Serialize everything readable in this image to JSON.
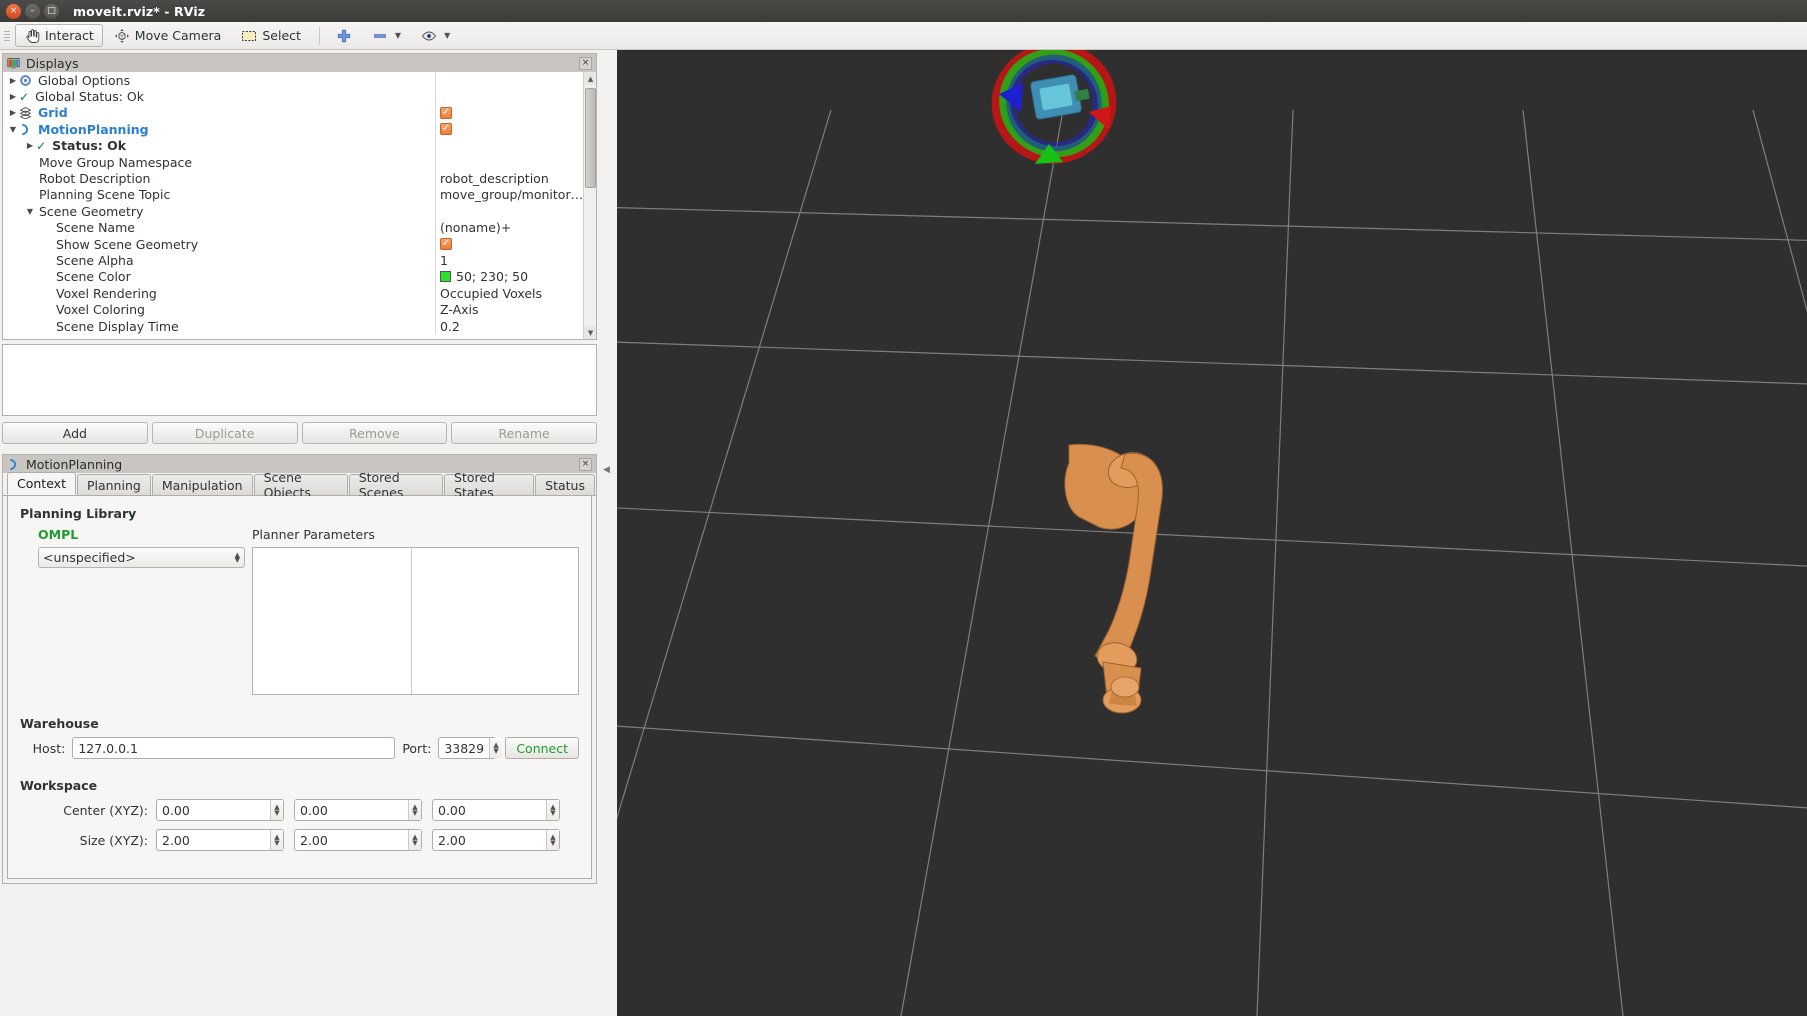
{
  "window": {
    "title": "moveit.rviz* - RViz",
    "close_glyph": "×",
    "min_glyph": "–",
    "max_glyph": "□"
  },
  "toolbar": {
    "items": [
      {
        "label": "Interact",
        "icon": "hand-cursor-icon",
        "active": true
      },
      {
        "label": "Move Camera",
        "icon": "move-camera-icon",
        "active": false
      },
      {
        "label": "Select",
        "icon": "select-rectangle-icon",
        "active": false
      }
    ],
    "add_tool_label": "+",
    "remove_tool_label": "−",
    "remove_dropdown_glyph": "▼",
    "view_icon_label": "eye-icon",
    "view_dropdown_glyph": "▼"
  },
  "displays": {
    "title": "Displays",
    "close_glyph": "×",
    "rows": [
      {
        "indent": 0,
        "arrow": "▶",
        "icon": "gear-icon",
        "label": "Global Options",
        "style": "plain",
        "value": "",
        "value_type": "none"
      },
      {
        "indent": 0,
        "arrow": "▶",
        "icon": "check-icon",
        "label": "Global Status: Ok",
        "style": "plain",
        "value": "",
        "value_type": "none"
      },
      {
        "indent": 0,
        "arrow": "▶",
        "icon": "grid-icon",
        "label": "Grid",
        "style": "link",
        "value": "",
        "value_type": "checkbox"
      },
      {
        "indent": 0,
        "arrow": "▼",
        "icon": "motion-icon",
        "label": "MotionPlanning",
        "style": "link",
        "value": "",
        "value_type": "checkbox"
      },
      {
        "indent": 1,
        "arrow": "▶",
        "icon": "check-icon",
        "label": "Status: Ok",
        "style": "bold",
        "value": "",
        "value_type": "none"
      },
      {
        "indent": 1,
        "arrow": "",
        "icon": "",
        "label": "Move Group Namespace",
        "style": "plain",
        "value": "",
        "value_type": "text"
      },
      {
        "indent": 1,
        "arrow": "",
        "icon": "",
        "label": "Robot Description",
        "style": "plain",
        "value": "robot_description",
        "value_type": "text"
      },
      {
        "indent": 1,
        "arrow": "",
        "icon": "",
        "label": "Planning Scene Topic",
        "style": "plain",
        "value": "move_group/monitor…",
        "value_type": "text"
      },
      {
        "indent": 1,
        "arrow": "▼",
        "icon": "",
        "label": "Scene Geometry",
        "style": "plain",
        "value": "",
        "value_type": "none"
      },
      {
        "indent": 2,
        "arrow": "",
        "icon": "",
        "label": "Scene Name",
        "style": "plain",
        "value": "(noname)+",
        "value_type": "text"
      },
      {
        "indent": 2,
        "arrow": "",
        "icon": "",
        "label": "Show Scene Geometry",
        "style": "plain",
        "value": "",
        "value_type": "checkbox"
      },
      {
        "indent": 2,
        "arrow": "",
        "icon": "",
        "label": "Scene Alpha",
        "style": "plain",
        "value": "1",
        "value_type": "text"
      },
      {
        "indent": 2,
        "arrow": "",
        "icon": "",
        "label": "Scene Color",
        "style": "plain",
        "value": "50; 230; 50",
        "value_type": "color",
        "swatch": "#2ee02e"
      },
      {
        "indent": 2,
        "arrow": "",
        "icon": "",
        "label": "Voxel Rendering",
        "style": "plain",
        "value": "Occupied Voxels",
        "value_type": "text"
      },
      {
        "indent": 2,
        "arrow": "",
        "icon": "",
        "label": "Voxel Coloring",
        "style": "plain",
        "value": "Z-Axis",
        "value_type": "text"
      },
      {
        "indent": 2,
        "arrow": "",
        "icon": "",
        "label": "Scene Display Time",
        "style": "plain",
        "value": "0.2",
        "value_type": "text"
      }
    ],
    "scroll_up_glyph": "▲",
    "scroll_down_glyph": "▼"
  },
  "display_buttons": [
    {
      "label": "Add",
      "enabled": true
    },
    {
      "label": "Duplicate",
      "enabled": false
    },
    {
      "label": "Remove",
      "enabled": false
    },
    {
      "label": "Rename",
      "enabled": false
    }
  ],
  "motion_planning": {
    "title": "MotionPlanning",
    "close_glyph": "×",
    "tabs": [
      {
        "label": "Context",
        "selected": true
      },
      {
        "label": "Planning",
        "selected": false
      },
      {
        "label": "Manipulation",
        "selected": false
      },
      {
        "label": "Scene Objects",
        "selected": false
      },
      {
        "label": "Stored Scenes",
        "selected": false
      },
      {
        "label": "Stored States",
        "selected": false
      },
      {
        "label": "Status",
        "selected": false
      }
    ],
    "context": {
      "planning_library_heading": "Planning Library",
      "library_name": "OMPL",
      "library_color": "#1f9c2f",
      "planner_select_value": "<unspecified>",
      "planner_parameters_label": "Planner Parameters",
      "warehouse_heading": "Warehouse",
      "host_label": "Host:",
      "host_value": "127.0.0.1",
      "port_label": "Port:",
      "port_value": "33829",
      "connect_label": "Connect",
      "connect_color": "#1f9c2f",
      "workspace_heading": "Workspace",
      "center_label": "Center (XYZ):",
      "center_values": [
        "0.00",
        "0.00",
        "0.00"
      ],
      "size_label": "Size (XYZ):",
      "size_values": [
        "2.00",
        "2.00",
        "2.00"
      ]
    }
  },
  "viewport": {
    "background_color": "#2f2f2f",
    "grid_line_color": "#9a9a9a",
    "robot_color": "#d98f4e",
    "marker_axis_colors": {
      "x": "#d01616",
      "y": "#16c216",
      "z": "#1616d0"
    }
  }
}
